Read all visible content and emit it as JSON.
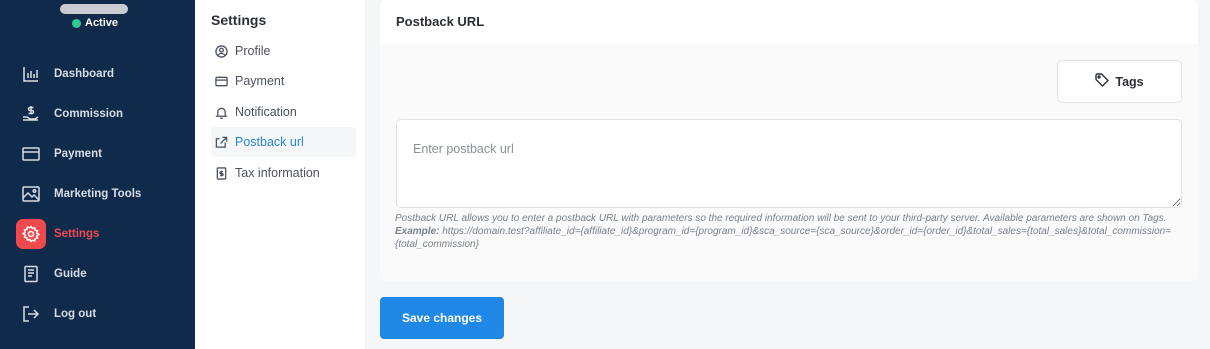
{
  "sidebar": {
    "status": "Active",
    "items": [
      {
        "label": "Dashboard",
        "icon": "bar-chart-icon",
        "active": false
      },
      {
        "label": "Commission",
        "icon": "money-hand-icon",
        "active": false
      },
      {
        "label": "Payment",
        "icon": "credit-card-icon",
        "active": false
      },
      {
        "label": "Marketing Tools",
        "icon": "image-icon",
        "active": false
      },
      {
        "label": "Settings",
        "icon": "gear-icon",
        "active": true
      },
      {
        "label": "Guide",
        "icon": "book-icon",
        "active": false
      },
      {
        "label": "Log out",
        "icon": "logout-icon",
        "active": false
      }
    ],
    "accent_color": "#f04a4f"
  },
  "settings_menu": {
    "title": "Settings",
    "items": [
      {
        "label": "Profile",
        "icon": "user-circle-icon"
      },
      {
        "label": "Payment",
        "icon": "credit-card-icon"
      },
      {
        "label": "Notification",
        "icon": "bell-icon"
      },
      {
        "label": "Postback url",
        "icon": "share-icon",
        "active": true
      },
      {
        "label": "Tax information",
        "icon": "tax-document-icon"
      }
    ]
  },
  "postback": {
    "title": "Postback URL",
    "tags_label": "Tags",
    "placeholder": "Enter postback url",
    "help_text": "Postback URL allows you to enter a postback URL with parameters so the required information will be sent to your third-party server. Available parameters are shown on Tags.",
    "example_label": "Example:",
    "example_text": "https://domain.test?affiliate_id={affiliate_id}&program_id={program_id}&sca_source={sca_source}&order_id={order_id}&total_sales={total_sales}&total_commission={total_commission}"
  },
  "actions": {
    "save_label": "Save changes"
  },
  "colors": {
    "sidebar_bg": "#0f2a4b",
    "primary": "#1f87e5",
    "status_green": "#2ecc8f"
  }
}
